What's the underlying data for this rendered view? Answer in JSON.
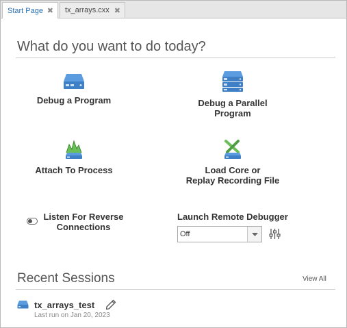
{
  "tabs": [
    {
      "label": "Start Page",
      "close": "✖",
      "active": true
    },
    {
      "label": "tx_arrays.cxx",
      "close": "✖",
      "active": false
    }
  ],
  "main": {
    "heading": "What do you want to do today?",
    "actions": {
      "debug_program": {
        "label": "Debug a Program",
        "icon": "drive-icon"
      },
      "debug_parallel": {
        "label_line1": "Debug a Parallel",
        "label_line2": "Program",
        "icon": "stacked-drives-icon"
      },
      "attach": {
        "label": "Attach To Process",
        "icon": "attach-process-icon"
      },
      "load_core": {
        "label_line1": "Load Core or",
        "label_line2": "Replay Recording File",
        "icon": "load-core-icon"
      }
    },
    "listen": {
      "label_line1": "Listen For Reverse",
      "label_line2": "Connections",
      "enabled": false
    },
    "remote": {
      "label": "Launch Remote Debugger",
      "selected": "Off"
    }
  },
  "recent": {
    "heading": "Recent Sessions",
    "view_all": "View All",
    "sessions": [
      {
        "name": "tx_arrays_test",
        "subtitle": "Last run on Jan 20, 2023"
      }
    ]
  },
  "colors": {
    "accent": "#2a6fb5",
    "icon_blue": "#4a8fd0",
    "icon_green": "#6bbf59"
  }
}
